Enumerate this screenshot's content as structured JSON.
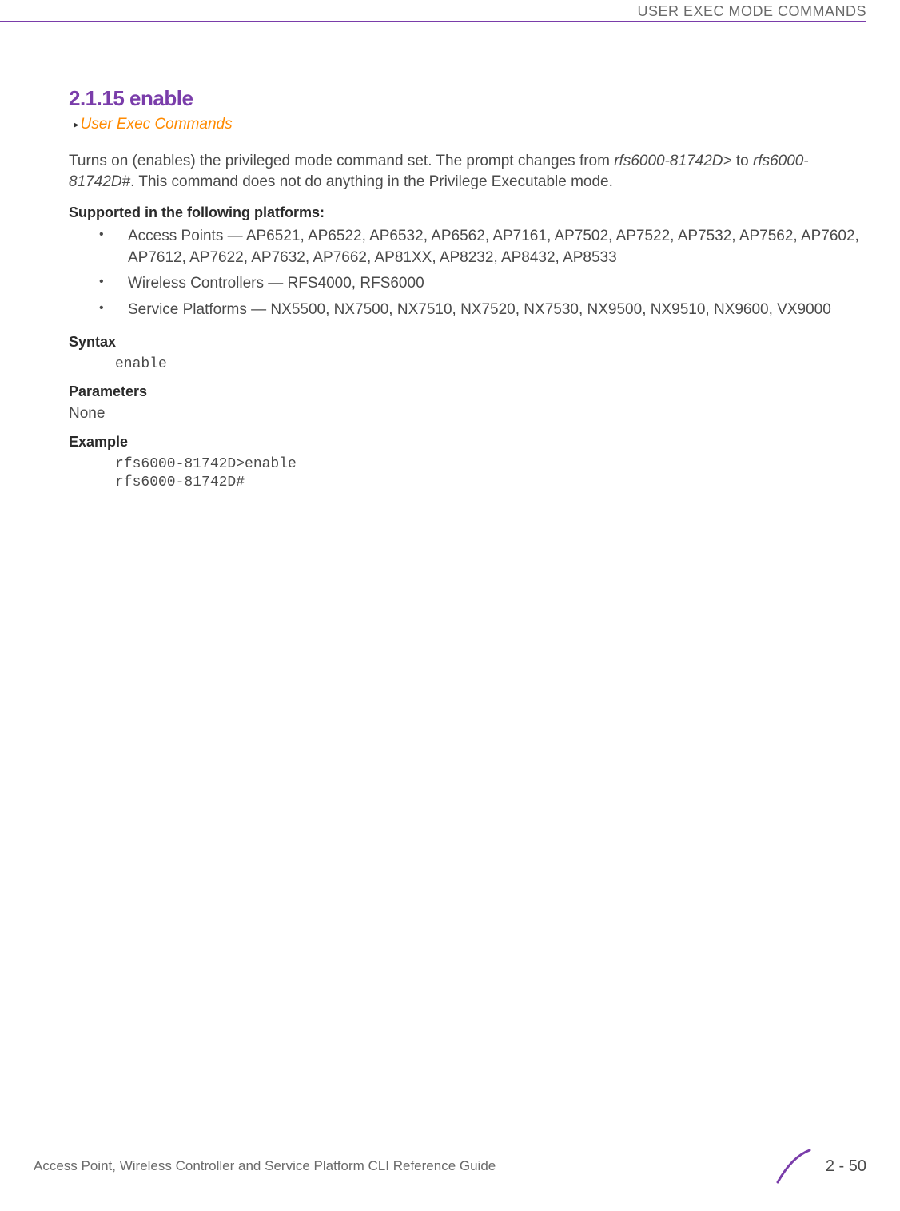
{
  "header": {
    "chapter_title": "USER EXEC MODE COMMANDS"
  },
  "section": {
    "number": "2.1.15",
    "title": "enable",
    "breadcrumb": "User Exec Commands"
  },
  "description": {
    "prefix": "Turns on (enables) the privileged mode command set. The prompt changes from ",
    "prompt1": "rfs6000-81742D>",
    "mid": " to ",
    "prompt2": "rfs6000-81742D#",
    "suffix": ". This command does not do anything in the Privilege Executable mode."
  },
  "platforms": {
    "heading": "Supported in the following platforms:",
    "items": [
      "Access Points — AP6521, AP6522, AP6532, AP6562, AP7161, AP7502, AP7522, AP7532, AP7562, AP7602, AP7612, AP7622, AP7632, AP7662, AP81XX, AP8232, AP8432, AP8533",
      "Wireless Controllers — RFS4000, RFS6000",
      "Service Platforms — NX5500, NX7500, NX7510, NX7520, NX7530, NX9500, NX9510, NX9600, VX9000"
    ]
  },
  "syntax": {
    "heading": "Syntax",
    "code": "enable"
  },
  "parameters": {
    "heading": "Parameters",
    "value": "None"
  },
  "example": {
    "heading": "Example",
    "code": "rfs6000-81742D>enable\nrfs6000-81742D#"
  },
  "footer": {
    "guide_title": "Access Point, Wireless Controller and Service Platform CLI Reference Guide",
    "page_number": "2 - 50"
  }
}
